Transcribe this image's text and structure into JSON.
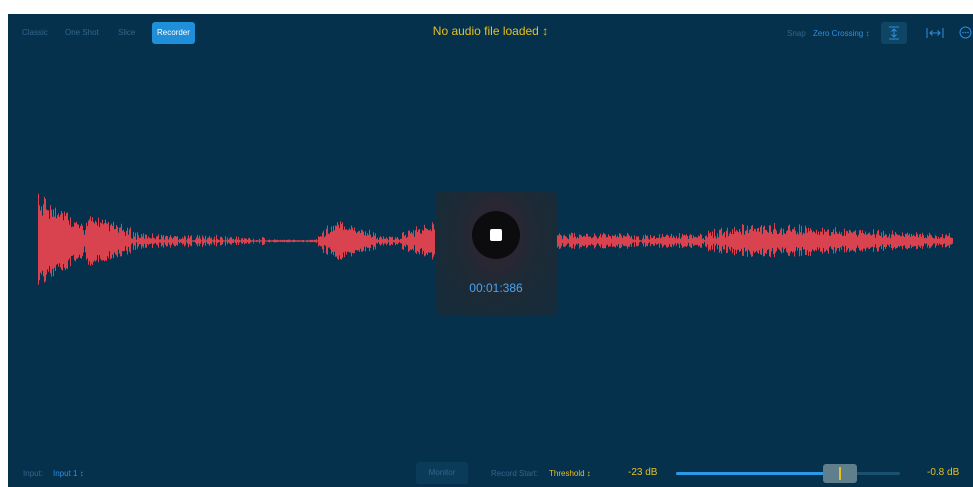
{
  "mode_tabs": [
    "Classic",
    "One Shot",
    "Slice",
    "Recorder"
  ],
  "active_mode": "Recorder",
  "file_selector": {
    "label": "No audio file loaded ↕"
  },
  "snap": {
    "label": "Snap",
    "value": "Zero Crossing ↕"
  },
  "tools": [
    "waveform-zoom-icon",
    "horizontal-zoom-icon",
    "more-options-icon"
  ],
  "recorder": {
    "timer": "00:01:386"
  },
  "bottom": {
    "input_label": "Input:",
    "input_value": "Input 1 ↕",
    "monitor_label": "Monitor",
    "record_start_label": "Record Start:",
    "record_start_value": "Threshold ↕",
    "threshold_value": "-23 dB",
    "peak_value": "-0.8 dB",
    "threshold_slider_fraction": 0.73
  },
  "colors": {
    "background": "#05314c",
    "accent": "#1f8fd9",
    "waveform": "#d8434f",
    "highlight": "#e6c022"
  }
}
